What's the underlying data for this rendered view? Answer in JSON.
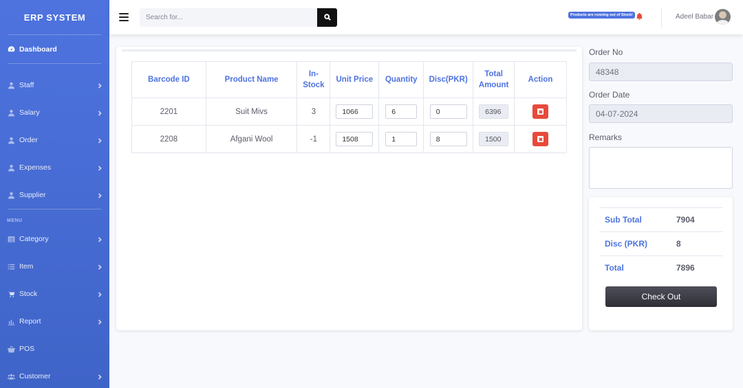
{
  "brand": "ERP SYSTEM",
  "sidebar": {
    "dashboard": {
      "label": "Dashboard",
      "icon": "gauge-icon"
    },
    "items_top": [
      {
        "label": "Staff",
        "icon": "user-icon"
      },
      {
        "label": "Salary",
        "icon": "user-icon"
      },
      {
        "label": "Order",
        "icon": "user-icon"
      },
      {
        "label": "Expenses",
        "icon": "user-icon"
      },
      {
        "label": "Supplier",
        "icon": "user-icon"
      }
    ],
    "section_heading": "MENU",
    "items_menu": [
      {
        "label": "Category",
        "icon": "list-alt-icon"
      },
      {
        "label": "Item",
        "icon": "list-icon"
      },
      {
        "label": "Stock",
        "icon": "cart-icon"
      },
      {
        "label": "Report",
        "icon": "bar-chart-icon"
      },
      {
        "label": "POS",
        "icon": "basket-icon"
      },
      {
        "label": "Customer",
        "icon": "users-icon"
      }
    ]
  },
  "topbar": {
    "search_placeholder": "Search for...",
    "stock_alert": "Products are running out of Stock!",
    "user_name": "Adeel Babar"
  },
  "table": {
    "headers": [
      "Barcode ID",
      "Product Name",
      "In-Stock",
      "Unit Price",
      "Quantity",
      "Disc(PKR)",
      "Total Amount",
      "Action"
    ],
    "header_lines": {
      "barcode": "Barcode ID",
      "product": "Product Name",
      "instock_1": "In-",
      "instock_2": "Stock",
      "unit_price": "Unit Price",
      "quantity": "Quantity",
      "disc": "Disc(PKR)",
      "total_1": "Total",
      "total_2": "Amount",
      "action": "Action"
    },
    "rows": [
      {
        "barcode": "2201",
        "product": "Suit Mivs",
        "in_stock": "3",
        "unit_price": "1066",
        "quantity": "6",
        "disc": "0",
        "total": "6396"
      },
      {
        "barcode": "2208",
        "product": "Afgani Wool",
        "in_stock": "-1",
        "unit_price": "1508",
        "quantity": "1",
        "disc": "8",
        "total": "1500"
      }
    ]
  },
  "order": {
    "no_label": "Order No",
    "no_value": "48348",
    "date_label": "Order Date",
    "date_value": "04-07-2024",
    "remarks_label": "Remarks",
    "remarks_value": ""
  },
  "summary": {
    "sub_total_label": "Sub Total",
    "sub_total_value": "7904",
    "disc_label": "Disc (PKR)",
    "disc_value": "8",
    "total_label": "Total",
    "total_value": "7896",
    "checkout_label": "Check Out"
  },
  "colors": {
    "primary": "#4e73df",
    "danger": "#e74a3b",
    "checkout": "#2e2f36"
  }
}
